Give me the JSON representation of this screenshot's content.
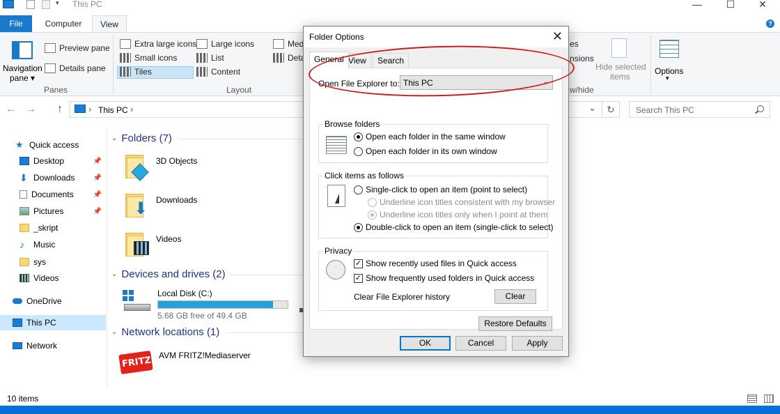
{
  "window": {
    "title": "This PC",
    "minimize_glyph": "—",
    "maximize_glyph": "☐",
    "close_glyph": "✕"
  },
  "ribbon": {
    "tabs": [
      {
        "label": "File"
      },
      {
        "label": "Computer"
      },
      {
        "label": "View"
      }
    ],
    "panes": {
      "navigation_pane": "Navigation",
      "navigation_pane_2": "pane ▾",
      "preview_pane": "Preview pane",
      "details_pane": "Details pane",
      "group_label": "Panes"
    },
    "layout": {
      "extra_large_icons": "Extra large icons",
      "large_icons": "Large icons",
      "medium_icons": "Med",
      "small_icons": "Small icons",
      "list": "List",
      "details": "Deta",
      "tiles": "Tiles",
      "content": "Content",
      "group_label": "Layout"
    },
    "show_hide": {
      "partial_1": "es",
      "partial_2": "nsions",
      "hide_selected": "Hide selected",
      "items": "items",
      "group_label": "w/hide"
    },
    "options": {
      "label": "Options",
      "arrow": "▾"
    }
  },
  "addressbar": {
    "back": "←",
    "forward": "→",
    "up": "↑",
    "path": "This PC",
    "chevron": "›",
    "dropdown": "⌄",
    "refresh": "↻",
    "search_placeholder": "Search This PC"
  },
  "navpane": {
    "items": [
      {
        "label": "Quick access",
        "pinned": false
      },
      {
        "label": "Desktop",
        "pinned": true
      },
      {
        "label": "Downloads",
        "pinned": true
      },
      {
        "label": "Documents",
        "pinned": true
      },
      {
        "label": "Pictures",
        "pinned": true
      },
      {
        "label": "_skript",
        "pinned": false
      },
      {
        "label": "Music",
        "pinned": false
      },
      {
        "label": "sys",
        "pinned": false
      },
      {
        "label": "Videos",
        "pinned": false
      },
      {
        "label": "OneDrive",
        "pinned": false
      },
      {
        "label": "This PC",
        "pinned": false,
        "selected": true
      },
      {
        "label": "Network",
        "pinned": false
      }
    ]
  },
  "content": {
    "folders_header": "Folders (7)",
    "folders": [
      {
        "name": "3D Objects"
      },
      {
        "name": "Downloads"
      },
      {
        "name": "Videos"
      }
    ],
    "devices_header": "Devices and drives (2)",
    "drive": {
      "name": "Local Disk (C:)",
      "free": "5.68 GB free of 49.4 GB",
      "used_fraction": 0.885
    },
    "network_header": "Network locations (1)",
    "network_item": {
      "name": "AVM FRITZ!Mediaserver",
      "logo_text": "FRITZ!"
    }
  },
  "statusbar": {
    "items": "10 items"
  },
  "dialog": {
    "title": "Folder Options",
    "close": "✕",
    "tabs": [
      "General",
      "View",
      "Search"
    ],
    "open_explorer_label": "Open File Explorer to:",
    "open_explorer_value": "This PC",
    "browse_folders": {
      "legend": "Browse folders",
      "opt_same": "Open each folder in the same window",
      "opt_own": "Open each folder in its own window"
    },
    "click_items": {
      "legend": "Click items as follows",
      "single": "Single-click to open an item (point to select)",
      "underline_consistent": "Underline icon titles consistent with my browser",
      "underline_point": "Underline icon titles only when I point at them",
      "double": "Double-click to open an item (single-click to select)"
    },
    "privacy": {
      "legend": "Privacy",
      "recent_files": "Show recently used files in Quick access",
      "frequent_folders": "Show frequently used folders in Quick access",
      "clear_history_label": "Clear File Explorer history",
      "clear_button": "Clear",
      "check": "✓"
    },
    "restore_defaults": "Restore Defaults",
    "ok": "OK",
    "cancel": "Cancel",
    "apply": "Apply"
  },
  "colors": {
    "accent": "#1979ca",
    "annotation_red": "#d2191e",
    "drive_fill": "#26a0da",
    "group_header": "#1e3287"
  }
}
